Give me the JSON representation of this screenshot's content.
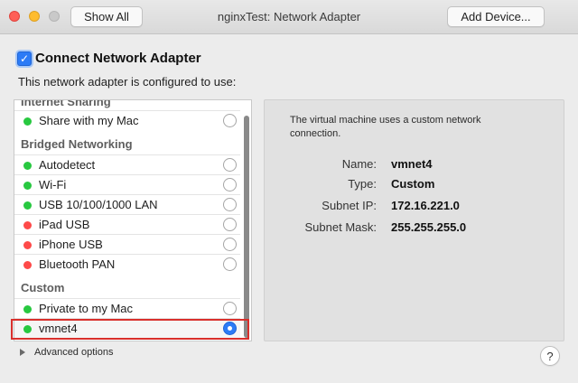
{
  "window": {
    "title": "nginxTest: Network Adapter",
    "show_all_label": "Show All",
    "add_device_label": "Add Device..."
  },
  "header": {
    "connect_label": "Connect Network Adapter",
    "connect_checked": true,
    "configured_text": "This network adapter is configured to use:"
  },
  "list": {
    "groups": {
      "internet_sharing": "Internet Sharing",
      "bridged": "Bridged Networking",
      "custom": "Custom"
    },
    "items": [
      {
        "label": "Share with my Mac",
        "status": "green",
        "selected": false
      },
      {
        "label": "Autodetect",
        "status": "green",
        "selected": false
      },
      {
        "label": "Wi-Fi",
        "status": "green",
        "selected": false
      },
      {
        "label": "USB 10/100/1000 LAN",
        "status": "green",
        "selected": false
      },
      {
        "label": "iPad USB",
        "status": "red",
        "selected": false
      },
      {
        "label": "iPhone USB",
        "status": "red",
        "selected": false
      },
      {
        "label": "Bluetooth PAN",
        "status": "red",
        "selected": false
      },
      {
        "label": "Private to my Mac",
        "status": "green",
        "selected": false
      },
      {
        "label": "vmnet4",
        "status": "green",
        "selected": true
      }
    ]
  },
  "details": {
    "description": "The virtual machine uses a custom network connection.",
    "name_label": "Name:",
    "name_value": "vmnet4",
    "type_label": "Type:",
    "type_value": "Custom",
    "subnet_ip_label": "Subnet IP:",
    "subnet_ip_value": "172.16.221.0",
    "subnet_mask_label": "Subnet Mask:",
    "subnet_mask_value": "255.255.255.0"
  },
  "footer": {
    "advanced_label": "Advanced options",
    "help_label": "?"
  },
  "colors": {
    "status_green": "#28c840",
    "status_red": "#fe4a49",
    "accent": "#2c7bf6",
    "highlight_box": "#d9302c"
  }
}
